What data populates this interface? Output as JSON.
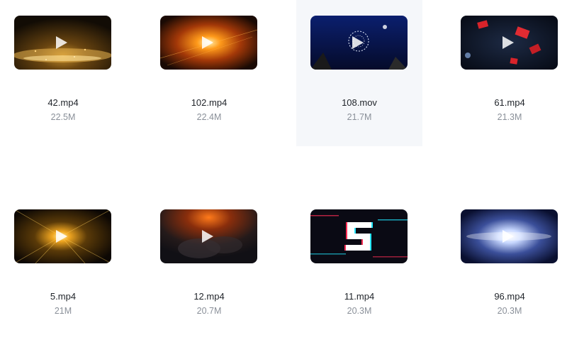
{
  "files": [
    {
      "name": "42.mp4",
      "size": "22.5M",
      "thumb_icon": "golden-particles-thumbnail"
    },
    {
      "name": "102.mp4",
      "size": "22.4M",
      "thumb_icon": "fire-explosion-thumbnail"
    },
    {
      "name": "108.mov",
      "size": "21.7M",
      "thumb_icon": "fireworks-night-thumbnail"
    },
    {
      "name": "61.mp4",
      "size": "21.3M",
      "thumb_icon": "red-shards-thumbnail"
    },
    {
      "name": "5.mp4",
      "size": "21M",
      "thumb_icon": "gold-burst-thumbnail"
    },
    {
      "name": "12.mp4",
      "size": "20.7M",
      "thumb_icon": "smoke-fire-thumbnail"
    },
    {
      "name": "11.mp4",
      "size": "20.3M",
      "thumb_icon": "glitch-number-five-thumbnail"
    },
    {
      "name": "96.mp4",
      "size": "20.3M",
      "thumb_icon": "blue-light-flare-thumbnail"
    }
  ],
  "colors": {
    "file_name": "#1f2329",
    "file_size": "#8a9099",
    "hover_background": "#f5f7fa"
  }
}
